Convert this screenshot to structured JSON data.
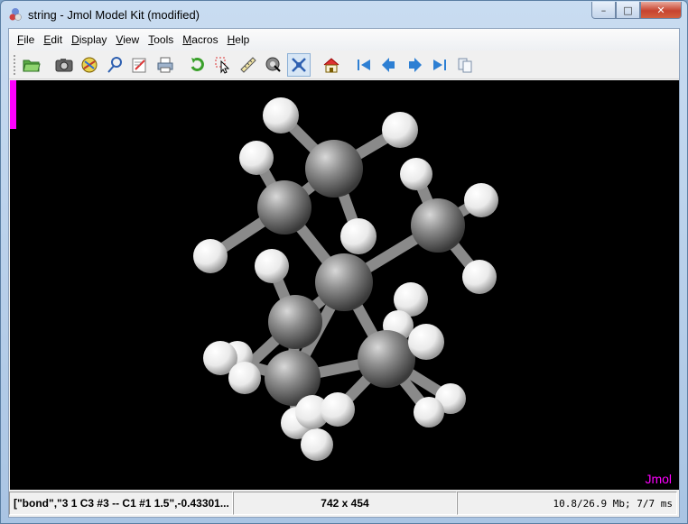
{
  "window": {
    "title": "string - Jmol Model Kit (modified)",
    "controls": {
      "minimize": "–",
      "maximize": "□",
      "close": "✕"
    }
  },
  "menu": [
    {
      "label": "File",
      "mnemonic": "F",
      "rest": "ile"
    },
    {
      "label": "Edit",
      "mnemonic": "E",
      "rest": "dit"
    },
    {
      "label": "Display",
      "mnemonic": "D",
      "rest": "isplay"
    },
    {
      "label": "View",
      "mnemonic": "V",
      "rest": "iew"
    },
    {
      "label": "Tools",
      "mnemonic": "T",
      "rest": "ools"
    },
    {
      "label": "Macros",
      "mnemonic": "M",
      "rest": "acros"
    },
    {
      "label": "Help",
      "mnemonic": "H",
      "rest": "elp"
    }
  ],
  "toolbar": [
    "open-folder-icon",
    "camera-icon",
    "povray-icon",
    "measure-probe-icon",
    "editor-icon",
    "print-icon",
    "rotate-icon",
    "select-pointer-icon",
    "ruler-icon",
    "pick-center-icon",
    "model-kit-icon",
    "home-icon",
    "first-frame-icon",
    "previous-frame-icon",
    "next-frame-icon",
    "last-frame-icon",
    "copy-frames-icon"
  ],
  "viewer": {
    "watermark": "Jmol",
    "colors": {
      "background": "#000000",
      "carbon": "#8c8c8c",
      "hydrogen": "#ffffff",
      "label": "#ff00ff"
    }
  },
  "status": {
    "left": "[\"bond\",\"3 1 C3 #3 -- C1 #1 1.5\",-0.43301...",
    "middle": "742 x 454",
    "right": "10.8/26.9 Mb;   7/7 ms"
  }
}
